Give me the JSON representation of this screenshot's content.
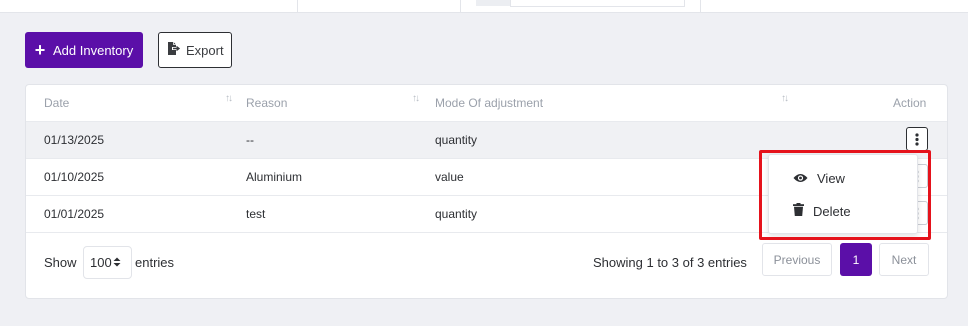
{
  "toolbar": {
    "add_label": "Add Inventory",
    "export_label": "Export"
  },
  "table": {
    "columns": [
      "Date",
      "Reason",
      "Mode Of adjustment",
      "Action"
    ],
    "rows": [
      {
        "date": "01/13/2025",
        "reason": "--",
        "mode": "quantity"
      },
      {
        "date": "01/10/2025",
        "reason": "Aluminium",
        "mode": "value"
      },
      {
        "date": "01/01/2025",
        "reason": "test",
        "mode": "quantity"
      }
    ]
  },
  "footer": {
    "show_label": "Show",
    "page_size": "100",
    "entries_label": "entries",
    "info": "Showing 1 to 3 of 3 entries",
    "prev_label": "Previous",
    "current_page": "1",
    "next_label": "Next"
  },
  "action_menu": {
    "items": [
      {
        "label": "View",
        "icon": "eye-icon"
      },
      {
        "label": "Delete",
        "icon": "trash-icon"
      }
    ]
  },
  "colors": {
    "brand": "#5b0fa8",
    "highlight": "#e5121b"
  }
}
